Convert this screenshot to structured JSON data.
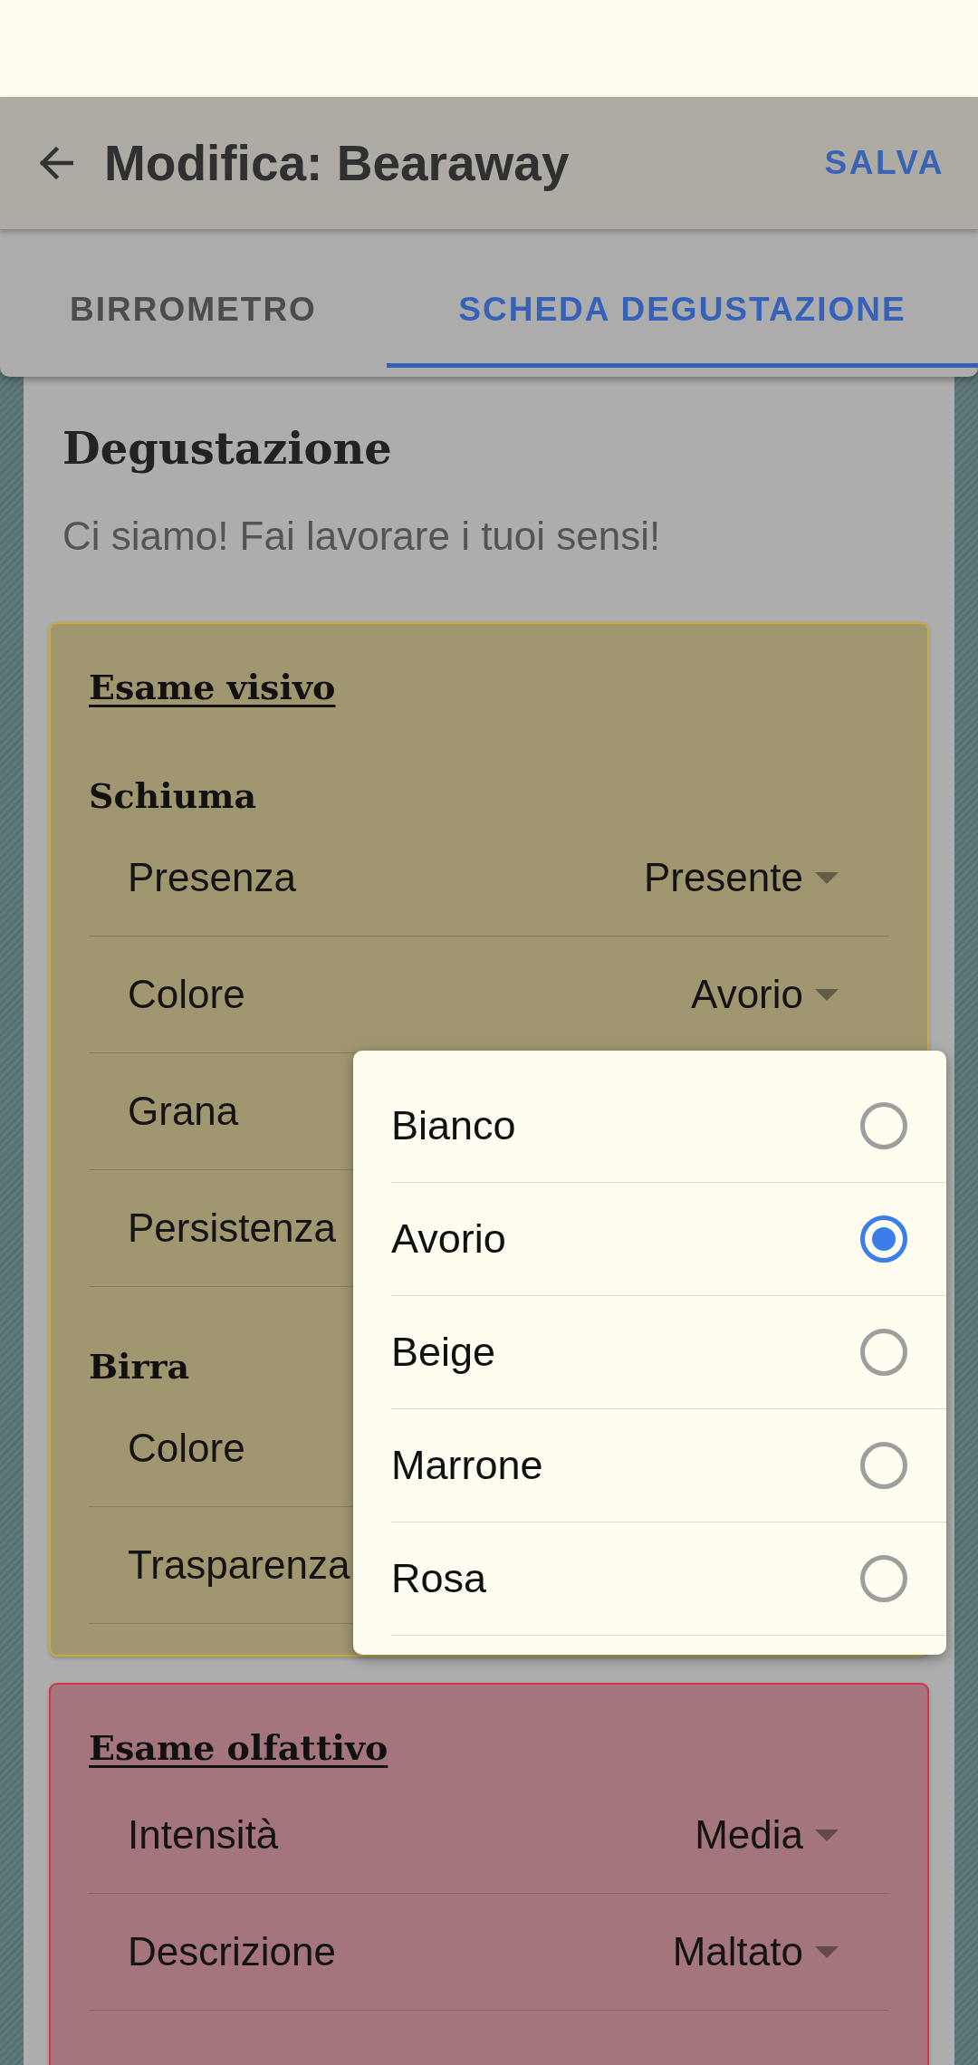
{
  "app_bar": {
    "title": "Modifica: Bearaway",
    "action": "SALVA"
  },
  "tabs": [
    {
      "label": "BIRROMETRO",
      "selected": false
    },
    {
      "label": "SCHEDA DEGUSTAZIONE",
      "selected": true
    }
  ],
  "page": {
    "title": "Degustazione",
    "subtitle": "Ci siamo! Fai lavorare i tuoi sensi!"
  },
  "sections": [
    {
      "title": "Esame visivo",
      "color": "#a09670",
      "groups": [
        {
          "title": "Schiuma",
          "rows": [
            {
              "label": "Presenza",
              "value": "Presente"
            },
            {
              "label": "Colore",
              "value": "Avorio",
              "options": [
                {
                  "label": "Bianco",
                  "selected": false
                },
                {
                  "label": "Avorio",
                  "selected": true
                },
                {
                  "label": "Beige",
                  "selected": false
                },
                {
                  "label": "Marrone",
                  "selected": false
                },
                {
                  "label": "Rosa",
                  "selected": false
                }
              ]
            },
            {
              "label": "Grana"
            },
            {
              "label": "Persistenza"
            }
          ]
        },
        {
          "title": "Birra",
          "rows": [
            {
              "label": "Colore"
            },
            {
              "label": "Trasparenza"
            }
          ]
        }
      ]
    },
    {
      "title": "Esame olfattivo",
      "color": "#a4757b",
      "groups": [
        {
          "rows": [
            {
              "label": "Intensità",
              "value": "Media"
            },
            {
              "label": "Descrizione",
              "value": "Maltato"
            }
          ]
        }
      ]
    }
  ]
}
